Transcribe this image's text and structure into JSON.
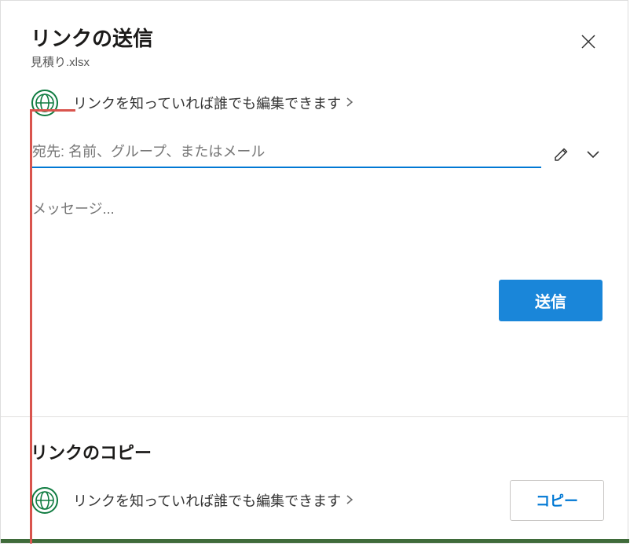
{
  "dialog": {
    "title": "リンクの送信",
    "filename": "見積り.xlsx",
    "permission_text": "リンクを知っていれば誰でも編集できます",
    "recipient_placeholder": "宛先: 名前、グループ、またはメール",
    "message_placeholder": "メッセージ...",
    "send_label": "送信"
  },
  "copy": {
    "title": "リンクのコピー",
    "permission_text": "リンクを知っていれば誰でも編集できます",
    "copy_label": "コピー"
  }
}
